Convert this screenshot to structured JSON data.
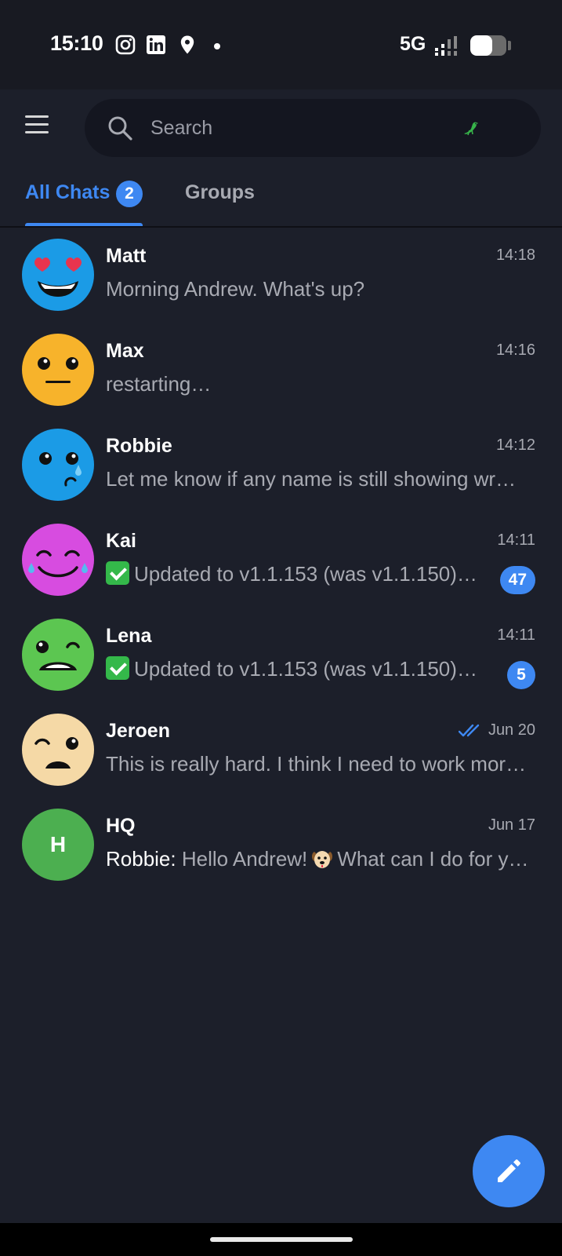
{
  "status_bar": {
    "time": "15:10",
    "icons": [
      "instagram-icon",
      "linkedin-icon",
      "location-icon",
      "dot-icon"
    ],
    "network": "5G",
    "battery_level": 0.6
  },
  "header": {
    "search_placeholder": "Search"
  },
  "tabs": [
    {
      "label": "All Chats",
      "badge": "2",
      "active": true
    },
    {
      "label": "Groups",
      "active": false
    }
  ],
  "chats": [
    {
      "name": "Matt",
      "time": "14:18",
      "preview": "Morning Andrew. What's up?",
      "avatar": "heart-eyes-emoji",
      "avatar_color": "#1b9be6"
    },
    {
      "name": "Max",
      "time": "14:16",
      "preview": "restarting…",
      "avatar": "neutral-face-emoji",
      "avatar_color": "#f7b32b"
    },
    {
      "name": "Robbie",
      "time": "14:12",
      "preview": "Let me know if any name is still showing wr…",
      "avatar": "sad-tear-emoji",
      "avatar_color": "#1b9be6"
    },
    {
      "name": "Kai",
      "time": "14:11",
      "preview": "Updated to v1.1.153 (was v1.1.150)…",
      "unread": "47",
      "avatar": "tears-of-joy-emoji",
      "avatar_color": "#d74ce0"
    },
    {
      "name": "Lena",
      "time": "14:11",
      "preview": "Updated to v1.1.153 (was v1.1.150). …",
      "unread": "5",
      "avatar": "grimace-wink-emoji",
      "avatar_color": "#5cc651"
    },
    {
      "name": "Jeroen",
      "time": "Jun 20",
      "preview": "This is really hard. I think I need to work mor…",
      "read_receipt": true,
      "avatar": "worried-face-emoji",
      "avatar_color": "#f5d9a6"
    },
    {
      "name": "HQ",
      "time": "Jun 17",
      "preview_sender": "Robbie:",
      "preview": "Hello Andrew!",
      "preview_after": "What can I do for y…",
      "avatar_letter": "H",
      "avatar_color": "#4caf50"
    }
  ],
  "colors": {
    "accent": "#3e88f2",
    "background": "#1c1f2a",
    "muted_text": "#a8aab2"
  }
}
